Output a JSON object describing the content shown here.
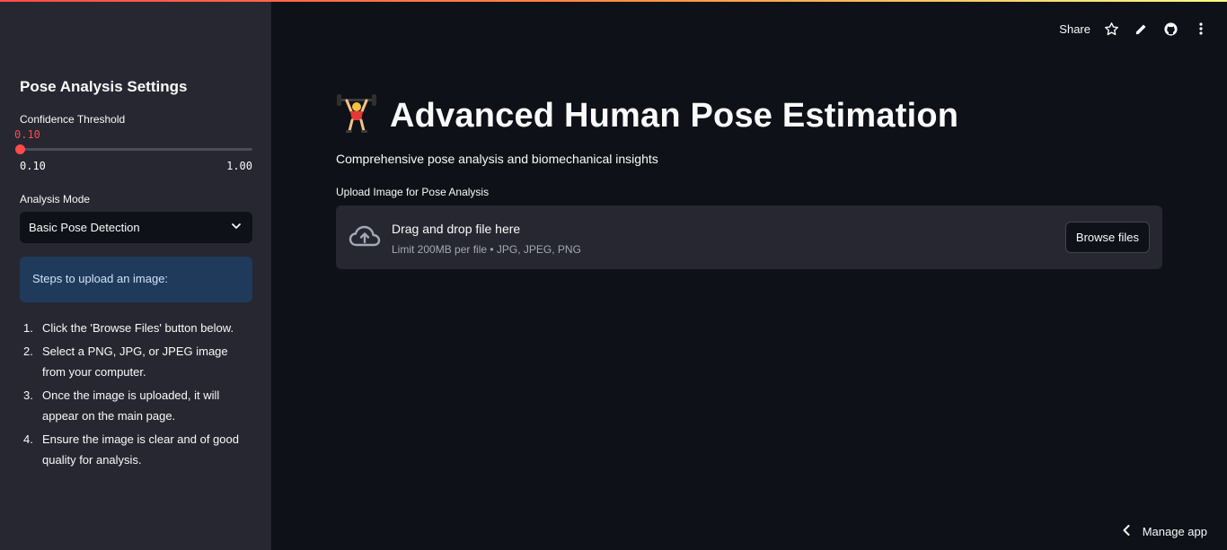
{
  "header": {
    "share_label": "Share",
    "icons": [
      "star-icon",
      "pencil-icon",
      "github-icon",
      "more-vertical-icon"
    ]
  },
  "sidebar": {
    "title": "Pose Analysis Settings",
    "slider": {
      "label": "Confidence Threshold",
      "value": "0.10",
      "min_label": "0.10",
      "max_label": "1.00",
      "fraction": 0.0
    },
    "select": {
      "label": "Analysis Mode",
      "value": "Basic Pose Detection"
    },
    "info": "Steps to upload an image:",
    "steps": [
      {
        "num": "1.",
        "text": "Click the 'Browse Files' button below."
      },
      {
        "num": "2.",
        "text": "Select a PNG, JPG, or JPEG image from your computer."
      },
      {
        "num": "3.",
        "text": "Once the image is uploaded, it will appear on the main page."
      },
      {
        "num": "4.",
        "text": "Ensure the image is clear and of good quality for analysis."
      }
    ]
  },
  "main": {
    "title_emoji": "weightlifter",
    "title": "Advanced Human Pose Estimation",
    "subtitle": "Comprehensive pose analysis and biomechanical insights",
    "upload": {
      "label": "Upload Image for Pose Analysis",
      "drag_text": "Drag and drop file here",
      "limit_text": "Limit 200MB per file • JPG, JPEG, PNG",
      "browse_label": "Browse files"
    }
  },
  "footer": {
    "manage_label": "Manage app"
  },
  "colors": {
    "accent": "#ff4b4b",
    "background": "#0e1117",
    "sidebar": "#262730",
    "info": "#1f3a5a"
  }
}
